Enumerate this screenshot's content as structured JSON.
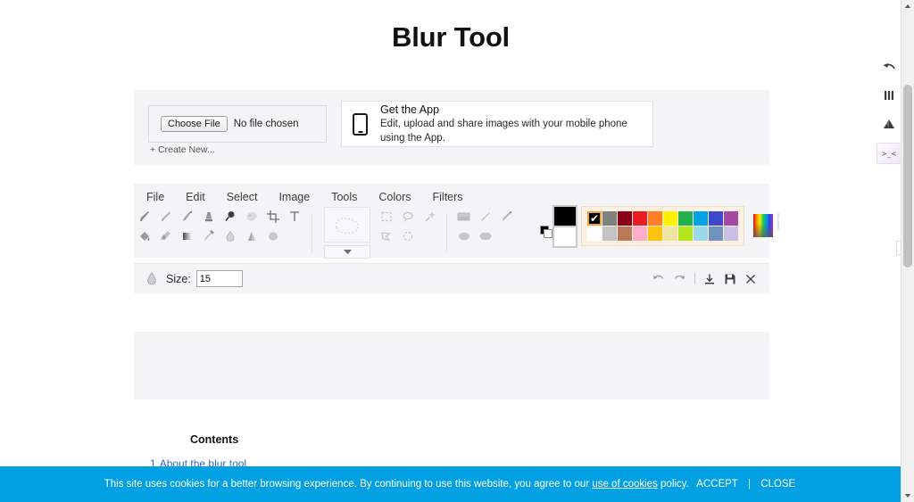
{
  "page": {
    "title": "Blur Tool"
  },
  "upload": {
    "choose_file_label": "Choose File",
    "no_file_text": "No file chosen",
    "create_new_label": "+ Create New...",
    "app_icon": "mobile-phone-icon",
    "app_title": "Get the App",
    "app_subtitle": "Edit, upload and share images with your mobile phone using the App."
  },
  "editor": {
    "menu": [
      {
        "label": "File"
      },
      {
        "label": "Edit"
      },
      {
        "label": "Select"
      },
      {
        "label": "Image"
      },
      {
        "label": "Tools"
      },
      {
        "label": "Colors"
      },
      {
        "label": "Filters"
      }
    ],
    "tools_row1": [
      {
        "name": "brush-tool-icon",
        "title": "Brush"
      },
      {
        "name": "pencil-tool-icon",
        "title": "Pencil"
      },
      {
        "name": "smudge-tool-icon",
        "title": "Smudge"
      },
      {
        "name": "stamp-tool-icon",
        "title": "Clone stamp"
      },
      {
        "name": "magnifier-tool-icon",
        "title": "Zoom"
      },
      {
        "name": "palette-tool-icon",
        "title": "Palette"
      },
      {
        "name": "crop-tool-icon",
        "title": "Crop"
      },
      {
        "name": "text-tool-icon",
        "title": "Text"
      }
    ],
    "tools_row2": [
      {
        "name": "paint-bucket-tool-icon",
        "title": "Fill"
      },
      {
        "name": "eraser-tool-icon",
        "title": "Eraser"
      },
      {
        "name": "gradient-tool-icon",
        "title": "Gradient"
      },
      {
        "name": "eyedropper-tool-icon",
        "title": "Color picker"
      },
      {
        "name": "blur-drop-tool-icon",
        "title": "Blur"
      },
      {
        "name": "sharpen-tool-icon",
        "title": "Sharpen"
      },
      {
        "name": "soften-tool-icon",
        "title": "Soften"
      }
    ],
    "shape_preview": "freeform-shape-preview",
    "shape_dropdown_icon": "chevron-down-icon",
    "select_tools": [
      {
        "name": "rectangle-select-icon",
        "title": "Rectangle select"
      },
      {
        "name": "lasso-select-icon",
        "title": "Lasso select"
      },
      {
        "name": "magic-wand-icon",
        "title": "Magic wand"
      },
      {
        "name": "polygon-select-icon",
        "title": "Polygon select"
      },
      {
        "name": "ellipse-select-icon",
        "title": "Ellipse select"
      }
    ],
    "shape_tools": [
      {
        "name": "rectangle-shape-icon",
        "title": "Rectangle"
      },
      {
        "name": "line-shape-icon",
        "title": "Line"
      },
      {
        "name": "pen-shape-icon",
        "title": "Pen"
      },
      {
        "name": "ellipse-shape-icon",
        "title": "Ellipse"
      },
      {
        "name": "polygon-shape-icon",
        "title": "Polygon"
      }
    ],
    "colors": {
      "foreground": "#000000",
      "background": "#ffffff",
      "palette_row1": [
        "#000000",
        "#808080",
        "#8b0017",
        "#ed1c24",
        "#ff7f27",
        "#fff200",
        "#22b14c",
        "#00a2e8",
        "#3f48cc",
        "#a349a4"
      ],
      "palette_row2": [
        "#ffffff",
        "#c3c3c3",
        "#b97a57",
        "#ffaec9",
        "#ffc20e",
        "#efe4a0",
        "#b5e61d",
        "#99d9ea",
        "#7092be",
        "#c8bfe7"
      ],
      "active_index": 0,
      "gradient_picker": "rainbow-gradient-picker-icon",
      "transparency_enabled_checkbox": "transparency-checkbox",
      "transparency_swatch": "transparent-swatch-icon"
    },
    "options": {
      "tool_icon": "blur-drop-icon",
      "size_label": "Size:",
      "size_value": "15",
      "actions": [
        {
          "name": "undo-icon",
          "title": "Undo"
        },
        {
          "name": "redo-icon",
          "title": "Redo"
        },
        {
          "name": "download-icon",
          "title": "Download"
        },
        {
          "name": "save-icon",
          "title": "Save"
        },
        {
          "name": "close-icon",
          "title": "Close"
        }
      ]
    }
  },
  "contents": {
    "heading": "Contents",
    "items": [
      {
        "number": "1",
        "label": "About the blur tool"
      }
    ]
  },
  "cookie": {
    "message_before": "This site uses cookies for a better browsing experience. By continuing to use this website, you agree to our",
    "link_label": "use of cookies",
    "message_after": "policy.",
    "accept_label": "ACCEPT",
    "separator": "|",
    "close_label": "CLOSE",
    "background": "#00a0e3"
  },
  "right_tools": [
    {
      "name": "undo-arrow-icon",
      "title": "Back"
    },
    {
      "name": "columns-icon",
      "title": "Columns"
    },
    {
      "name": "mountain-icon",
      "title": "Image"
    },
    {
      "name": "emoji-face-icon",
      "title": "Effects"
    }
  ],
  "scrollbar": {
    "up_icon": "scroll-up-icon",
    "down_icon": "scroll-down-icon"
  }
}
